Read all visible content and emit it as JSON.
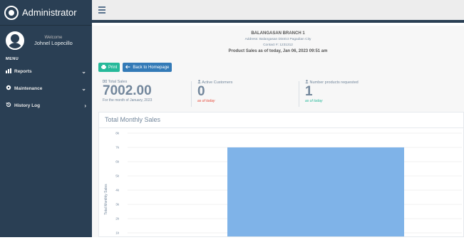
{
  "sidebar": {
    "brand_title": "Administrator",
    "welcome": "Welcome",
    "username": "Johnel Lopecillo",
    "menu_label": "MENU",
    "items": [
      {
        "label": "Reports",
        "icon": "bar-chart-icon",
        "chevron": "⌄"
      },
      {
        "label": "Maintenance",
        "icon": "gear-icon",
        "chevron": "⌄"
      },
      {
        "label": "History Log",
        "icon": "history-icon",
        "chevron": "›"
      }
    ]
  },
  "header": {
    "branch_name": "BALANGASAN BRANCH 1",
    "address": "Address: Balangasan District Pagadian City",
    "contact": "Contact #: 1231312",
    "as_of": "Product Sales as of today, Jan 06, 2023 09:51 am"
  },
  "buttons": {
    "print_label": "Print",
    "home_label": "Back to Homepage"
  },
  "stats": [
    {
      "title": "Total Sales",
      "value": "7002.00",
      "sub": "For the month of January, 2023",
      "sub_color": "#73879c"
    },
    {
      "title": "Active Customers",
      "value": "0",
      "sub": "as of today",
      "sub_color": "#e74c3c"
    },
    {
      "title": "Number products requested",
      "value": "1",
      "sub": "as of today",
      "sub_color": "#26b99a"
    }
  ],
  "colors": {
    "sidebar_bg": "#2a3f54",
    "bar": "#7fb3e8",
    "print_button": "#26b99a",
    "home_button": "#337ab7"
  },
  "chart_data": {
    "type": "bar",
    "title": "Total Monthly Sales",
    "ylabel": "Total Monthly Sales",
    "xlabel": "",
    "categories": [
      ""
    ],
    "values": [
      7002
    ],
    "yticks": [
      "8k",
      "7k",
      "6k",
      "5k",
      "4k",
      "3k",
      "2k",
      "1k"
    ],
    "ylim": [
      0,
      8000
    ],
    "grid": true
  }
}
